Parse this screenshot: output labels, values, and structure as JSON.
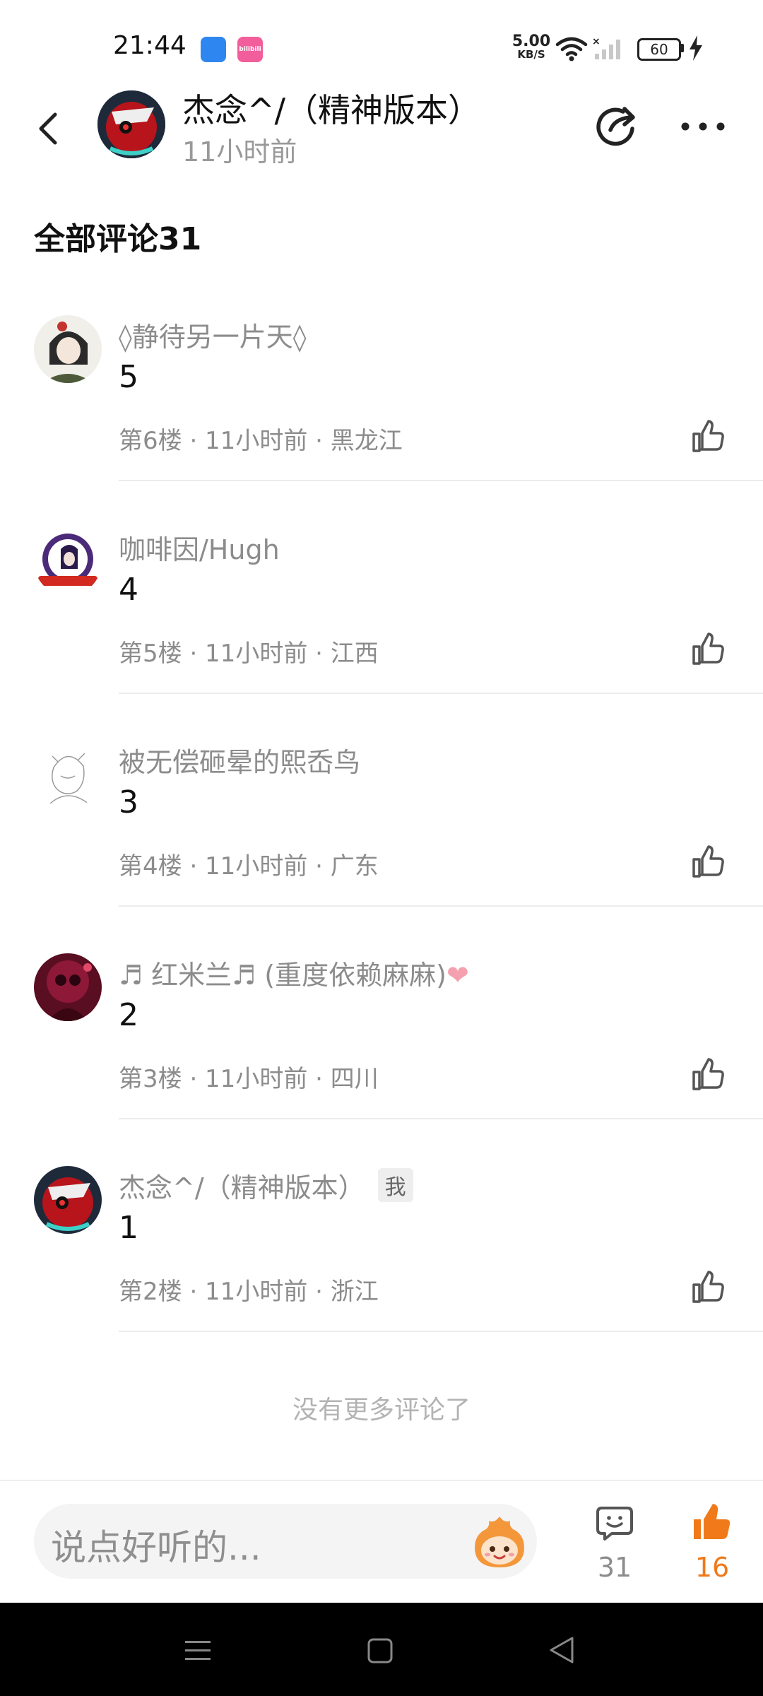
{
  "status_bar": {
    "time": "21:44",
    "net_speed_value": "5.00",
    "net_speed_unit": "KB/S",
    "battery": "60",
    "bili_label": "bilibili"
  },
  "header": {
    "author": "杰念^/（精神版本）",
    "posted": "11小时前"
  },
  "section_title": "全部评论31",
  "comments": [
    {
      "user": "◊静待另一片天◊",
      "text": "5",
      "meta": "第6楼 · 11小时前 · 黑龙江"
    },
    {
      "user": "咖啡因/Hugh",
      "text": "4",
      "meta": "第5楼 · 11小时前 · 江西"
    },
    {
      "user": "被无偿砸晕的熙岙鸟",
      "text": "3",
      "meta": "第4楼 · 11小时前 · 广东"
    },
    {
      "user": "♬ 红米兰♬ (重度依赖麻麻)",
      "heart": "❤",
      "text": "2",
      "meta": "第3楼 · 11小时前 · 四川"
    },
    {
      "user": "杰念^/（精神版本）",
      "badge": "我",
      "text": "1",
      "meta": "第2楼 · 11小时前 · 浙江"
    }
  ],
  "no_more_text": "没有更多评论了",
  "bottom_bar": {
    "input_placeholder": "说点好听的...",
    "comment_count": "31",
    "like_count": "16",
    "like_color": "#f07a1a"
  },
  "icons": {
    "back": "chevron-left-icon",
    "share": "share-icon",
    "more": "more-dots-icon",
    "like": "thumbs-up-icon",
    "comments": "chat-bubble-icon",
    "emoji": "emoji-face-icon"
  }
}
